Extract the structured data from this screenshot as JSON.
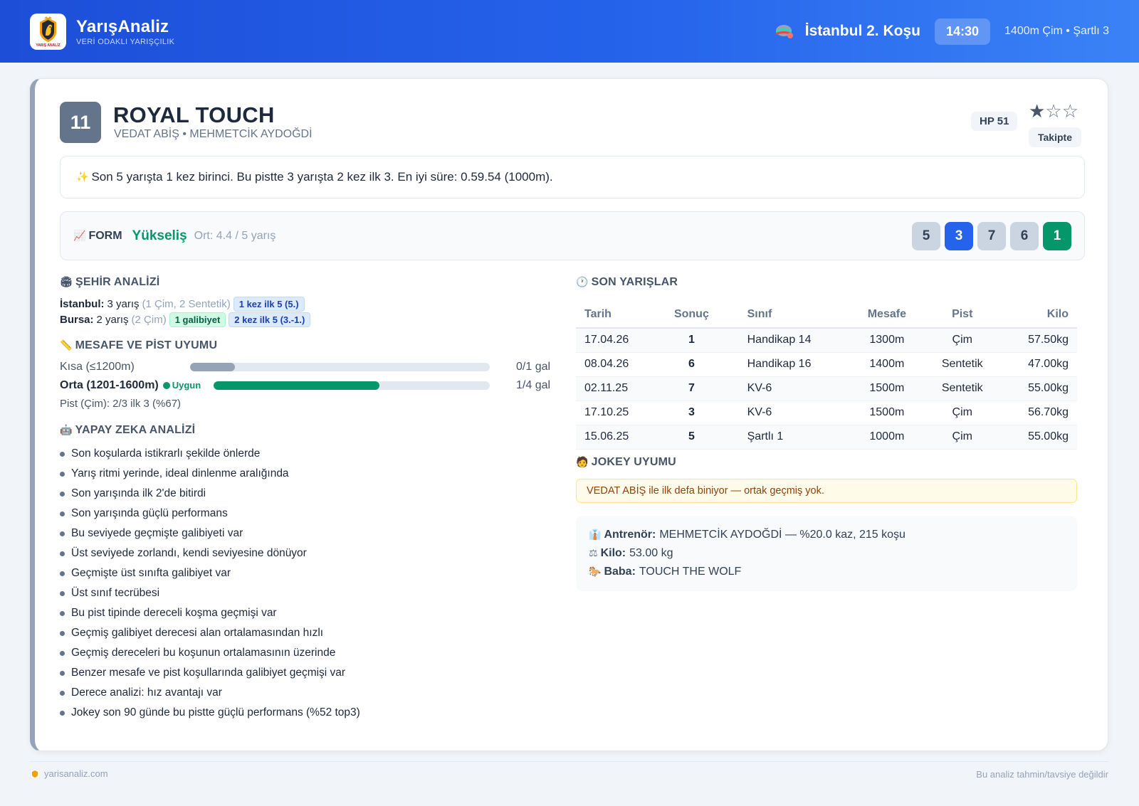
{
  "header": {
    "brand_name": "YarışAnaliz",
    "brand_tag": "VERİ ODAKLI YARIŞÇILIK",
    "logo_text": "YARIŞ ANALİZ",
    "race_icon": "jockey-cap-icon",
    "race_title": "İstanbul 2. Koşu",
    "race_time": "14:30",
    "race_info": "1400m Çim • Şartlı 3"
  },
  "horse": {
    "number": "11",
    "name": "ROYAL TOUCH",
    "subtitle": "VEDAT ABİŞ • MEHMETCİK AYDOĞDİ",
    "hp": "HP 51",
    "stars_filled": 1,
    "stars_total": 3,
    "follow_label": "Takipte"
  },
  "summary": {
    "icon": "sparkles-icon",
    "text": "Son 5 yarışta 1 kez birinci. Bu pistte 3 yarışta 2 kez ilk 3. En iyi süre: 0.59.54 (1000m)."
  },
  "form": {
    "icon": "chart-up-icon",
    "label": "FORM",
    "trend": "Yükseliş",
    "average": "Ort: 4.4 / 5 yarış",
    "results": [
      {
        "value": "5",
        "style": "gray"
      },
      {
        "value": "3",
        "style": "blue"
      },
      {
        "value": "7",
        "style": "gray"
      },
      {
        "value": "6",
        "style": "gray"
      },
      {
        "value": "1",
        "style": "green"
      }
    ]
  },
  "city": {
    "title": "ŞEHİR ANALİZİ",
    "rows": [
      {
        "city": "İstanbul:",
        "count": "3 yarış",
        "detail": "(1 Çim, 2 Sentetik)",
        "tags": [
          {
            "text": "1 kez ilk 5 (5.)",
            "style": "blue"
          }
        ]
      },
      {
        "city": "Bursa:",
        "count": "2 yarış",
        "detail": "(2 Çim)",
        "tags": [
          {
            "text": "1 galibiyet",
            "style": "green"
          },
          {
            "text": "2 kez ilk 5 (3.-1.)",
            "style": "blue"
          }
        ]
      }
    ]
  },
  "distance": {
    "title": "MESAFE VE PİST UYUMU",
    "rows": [
      {
        "label": "Kısa (≤1200m)",
        "badge": "",
        "fill": 0.15,
        "color": "#94a3b8",
        "result": "0/1 gal"
      },
      {
        "label": "Orta (1201-1600m)",
        "badge": "Uygun",
        "fill": 0.6,
        "color": "#059669",
        "result": "1/4 gal"
      }
    ],
    "pist": "Pist (Çim): 2/3 ilk 3 (%67)"
  },
  "ai": {
    "title": "YAPAY ZEKA ANALİZİ",
    "items": [
      "Son koşularda istikrarlı şekilde önlerde",
      "Yarış ritmi yerinde, ideal dinlenme aralığında",
      "Son yarışında ilk 2'de bitirdi",
      "Son yarışında güçlü performans",
      "Bu seviyede geçmişte galibiyeti var",
      "Üst seviyede zorlandı, kendi seviyesine dönüyor",
      "Geçmişte üst sınıfta galibiyet var",
      "Üst sınıf tecrübesi",
      "Bu pist tipinde dereceli koşma geçmişi var",
      "Geçmiş galibiyet derecesi alan ortalamasından hızlı",
      "Geçmiş dereceleri bu koşunun ortalamasının üzerinde",
      "Benzer mesafe ve pist koşullarında galibiyet geçmişi var",
      "Derece analizi: hız avantajı var",
      "Jokey son 90 günde bu pistte güçlü performans (%52 top3)"
    ]
  },
  "recent": {
    "title": "SON YARIŞLAR",
    "columns": [
      "Tarih",
      "Sonuç",
      "Sınıf",
      "Mesafe",
      "Pist",
      "Kilo"
    ],
    "rows": [
      {
        "date": "17.04.26",
        "result": "1",
        "result_style": "win",
        "class": "Handikap 14",
        "distance": "1300m",
        "track": "Çim",
        "weight": "57.50kg"
      },
      {
        "date": "08.04.26",
        "result": "6",
        "result_style": "other",
        "class": "Handikap 16",
        "distance": "1400m",
        "track": "Sentetik",
        "weight": "47.00kg"
      },
      {
        "date": "02.11.25",
        "result": "7",
        "result_style": "other",
        "class": "KV-6",
        "distance": "1500m",
        "track": "Sentetik",
        "weight": "55.00kg"
      },
      {
        "date": "17.10.25",
        "result": "3",
        "result_style": "top3",
        "class": "KV-6",
        "distance": "1500m",
        "track": "Çim",
        "weight": "56.70kg"
      },
      {
        "date": "15.06.25",
        "result": "5",
        "result_style": "other",
        "class": "Şartlı 1",
        "distance": "1000m",
        "track": "Çim",
        "weight": "55.00kg"
      }
    ]
  },
  "jockey": {
    "title": "JOKEY UYUMU",
    "note": "VEDAT ABİŞ ile ilk defa biniyor — ortak geçmiş yok."
  },
  "info": {
    "trainer_label": "Antrenör:",
    "trainer_value": "MEHMETCİK AYDOĞDİ — %20.0 kaz, 215 koşu",
    "weight_label": "Kilo:",
    "weight_value": "53.00 kg",
    "sire_label": "Baba:",
    "sire_value": "TOUCH THE WOLF"
  },
  "footer": {
    "site": "yarisanaliz.com",
    "disclaimer": "Bu analiz tahmin/tavsiye değildir"
  },
  "colors": {
    "header_blue": "#2563eb",
    "win_green": "#059669",
    "top3_orange": "#d97706",
    "gray_chip": "#cbd5e1"
  }
}
